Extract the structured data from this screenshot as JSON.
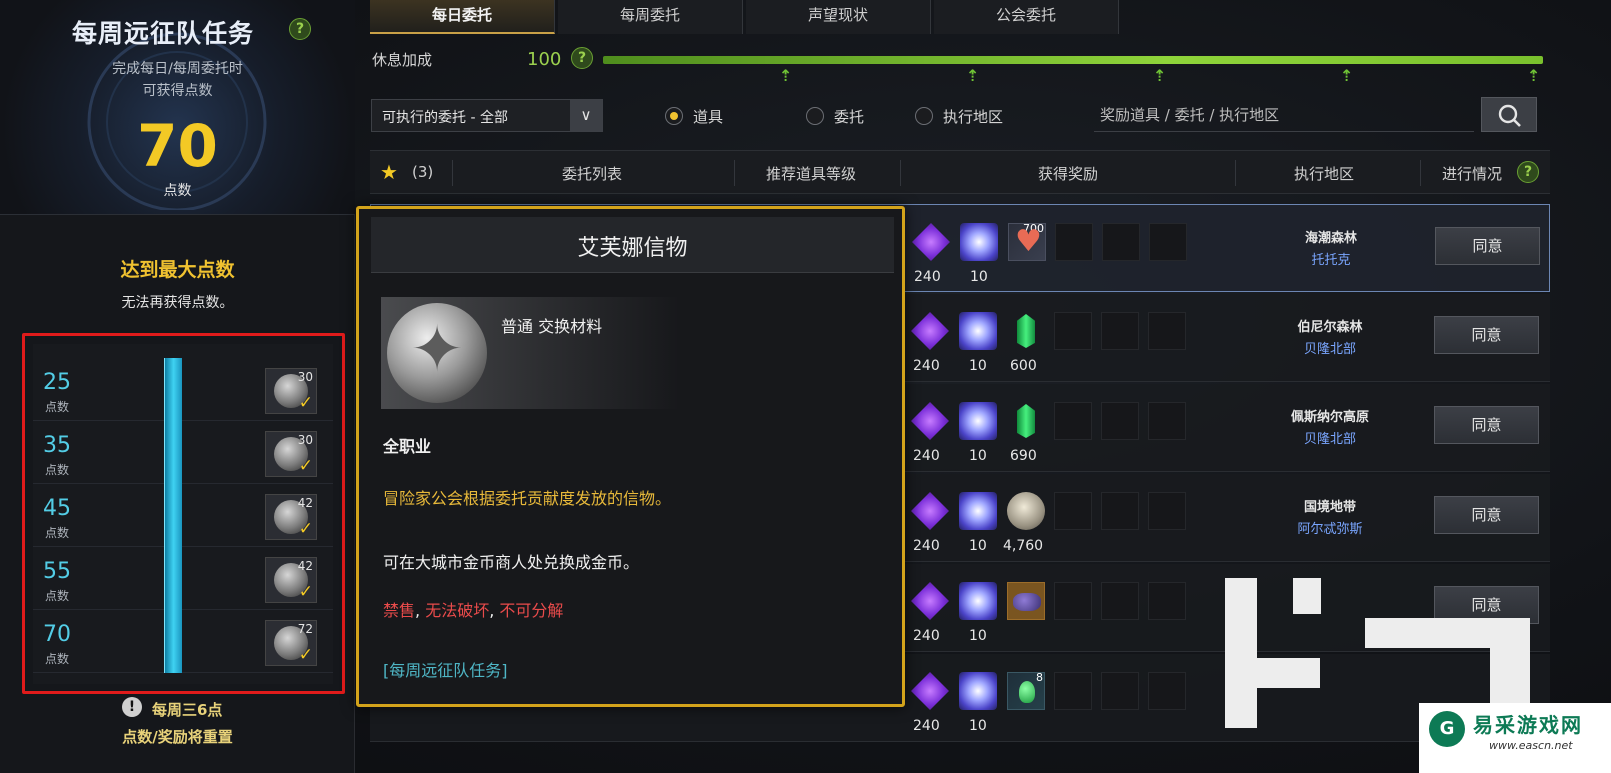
{
  "left_panel": {
    "title": "每周远征队任务",
    "help": "?",
    "sub1": "完成每日/每周委托时",
    "sub2": "可获得点数",
    "points": "70",
    "points_unit": "点数",
    "max_title": "达到最大点数",
    "max_sub": "无法再获得点数。",
    "tiers": [
      {
        "value": "25",
        "unit": "点数",
        "count": "30",
        "claimed": "✓"
      },
      {
        "value": "35",
        "unit": "点数",
        "count": "30",
        "claimed": "✓"
      },
      {
        "value": "45",
        "unit": "点数",
        "count": "42",
        "claimed": "✓"
      },
      {
        "value": "55",
        "unit": "点数",
        "count": "42",
        "claimed": "✓"
      },
      {
        "value": "70",
        "unit": "点数",
        "count": "72",
        "claimed": "✓"
      }
    ],
    "reset_icon": "!",
    "reset_line1": "每周三6点",
    "reset_line2": "点数/奖励将重置"
  },
  "tabs": [
    {
      "label": "每日委托",
      "active": true
    },
    {
      "label": "每周委托",
      "active": false
    },
    {
      "label": "声望现状",
      "active": false
    },
    {
      "label": "公会委托",
      "active": false
    }
  ],
  "rest": {
    "label": "休息加成",
    "value": "100",
    "help": "?",
    "fill_percent": 100
  },
  "filter": {
    "select_value": "可执行的委托 - 全部",
    "radios": [
      {
        "label": "道具",
        "selected": true
      },
      {
        "label": "委托",
        "selected": false
      },
      {
        "label": "执行地区",
        "selected": false
      }
    ],
    "search_placeholder": "奖励道具 / 委托 / 执行地区"
  },
  "table_header": {
    "star_count": "(3)",
    "col_list": "委托列表",
    "col_level": "推荐道具等级",
    "col_reward": "获得奖励",
    "col_region": "执行地区",
    "col_progress": "进行情况",
    "help": "?"
  },
  "rows": [
    {
      "r1": "240",
      "r2": "10",
      "r3": "",
      "r3_badge": "700",
      "region": "海潮森林",
      "npc": "托托克",
      "action": "同意"
    },
    {
      "r1": "240",
      "r2": "10",
      "r3": "600",
      "r3_badge": "",
      "region": "伯尼尔森林",
      "npc": "贝隆北部",
      "action": "同意"
    },
    {
      "r1": "240",
      "r2": "10",
      "r3": "690",
      "r3_badge": "",
      "region": "佩斯纳尔高原",
      "npc": "贝隆北部",
      "action": "同意"
    },
    {
      "r1": "240",
      "r2": "10",
      "r3": "4,760",
      "r3_badge": "",
      "region": "国境地带",
      "npc": "阿尔忒弥斯",
      "action": "同意"
    },
    {
      "r1": "240",
      "r2": "10",
      "r3": "",
      "r3_badge": "",
      "region": "",
      "npc": "",
      "action": "同意"
    },
    {
      "r1": "240",
      "r2": "10",
      "r3": "",
      "r3_badge": "8",
      "region": "",
      "npc": "",
      "action": ""
    }
  ],
  "tooltip": {
    "title": "艾芙娜信物",
    "type": "普通 交换材料",
    "class": "全职业",
    "desc": "冒险家公会根据委托贡献度发放的信物。",
    "exchange": "可在大城市金币商人处兑换成金币。",
    "restr1": "禁售",
    "restr2": "无法破坏",
    "restr3": "不可分解",
    "restr_sep": ", ",
    "source": "[每周远征队任务]"
  },
  "watermark": {
    "logo_letter": "G",
    "name": "易采游戏网",
    "url": "www.eascn.net"
  },
  "colors": {
    "accent_gold": "#f3c925",
    "tier_blue": "#53cde6",
    "highlight_border": "#e01b1b",
    "tooltip_border": "#d3a31b",
    "rest_green": "#8fd43a"
  },
  "icons": {
    "star": "star-icon",
    "search": "search-icon",
    "dropdown": "chevron-down-icon",
    "arrow_up": "arrow-up-icon"
  }
}
